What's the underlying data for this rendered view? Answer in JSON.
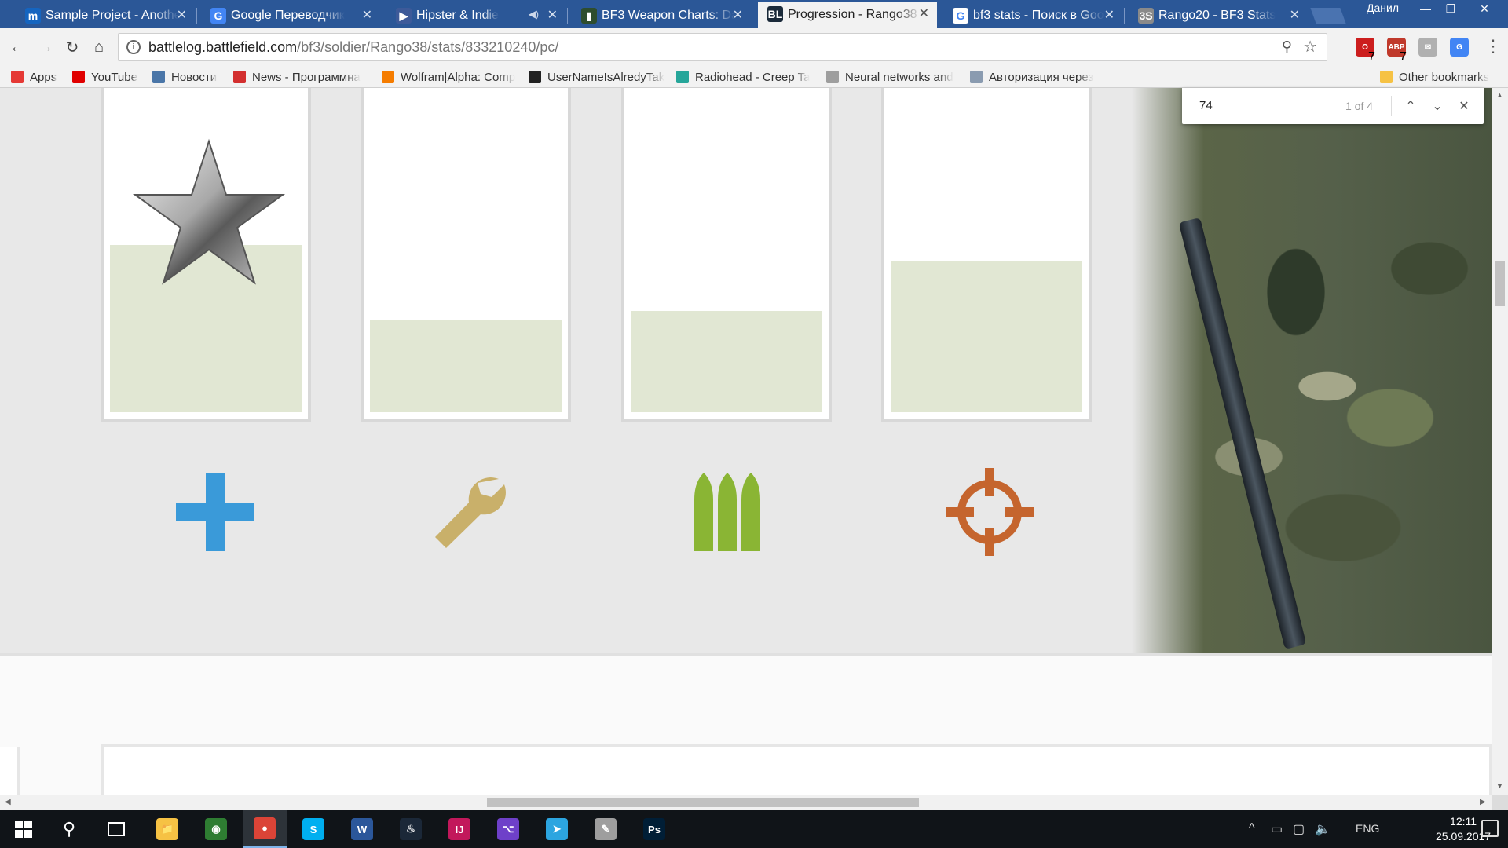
{
  "browser": {
    "tabs": [
      {
        "title": "Sample Project - Anothe",
        "favicon": "m",
        "color": "#1565c0",
        "active": false
      },
      {
        "title": "Google Переводчик",
        "favicon": "G",
        "color": "#4285f4",
        "active": false
      },
      {
        "title": "Hipster & Indie",
        "favicon": "▶",
        "color": "#3d5a99",
        "active": false,
        "audio": true
      },
      {
        "title": "BF3 Weapon Charts: Dar",
        "favicon": "▮",
        "color": "#2e4d2e",
        "active": false
      },
      {
        "title": "Progression - Rango38 -",
        "favicon": "BL",
        "color": "#1b2a3a",
        "active": true
      },
      {
        "title": "bf3 stats - Поиск в Goo",
        "favicon": "G",
        "color": "#ffffff",
        "active": false
      },
      {
        "title": "Rango20 - BF3 Stats",
        "favicon": "3S",
        "color": "#8a8a8a",
        "active": false
      }
    ],
    "user": "Данил",
    "window_controls": {
      "minimize": "—",
      "restore": "❐",
      "close": "✕"
    },
    "url": {
      "host": "battlelog.battlefield.com",
      "path": "/bf3/soldier/Rango38/stats/833210240/pc/"
    },
    "extensions": [
      {
        "name": "opera-extension-icon",
        "label": "O",
        "color": "#cc1e1e",
        "badge": "7"
      },
      {
        "name": "adblock-icon",
        "label": "ABP",
        "color": "#c0392b",
        "badge": "7"
      },
      {
        "name": "pdf-extension-icon",
        "label": "✉",
        "color": "#b0b0b0",
        "badge": ""
      },
      {
        "name": "translate-extension-icon",
        "label": "G",
        "color": "#4285f4",
        "badge": ""
      }
    ],
    "bookmarks": [
      {
        "label": "Apps",
        "icon": "apps-grid-icon",
        "color": "#e53935"
      },
      {
        "label": "YouTube",
        "icon": "youtube-icon",
        "color": "#e00000"
      },
      {
        "label": "Новости",
        "icon": "vk-icon",
        "color": "#4a76a8"
      },
      {
        "label": "News - Программна",
        "icon": "bt-icon",
        "color": "#d32f2f"
      },
      {
        "label": "Wolfram|Alpha: Comp",
        "icon": "wolfram-icon",
        "color": "#f57c00"
      },
      {
        "label": "UserNameIsAlredyTak",
        "icon": "github-icon",
        "color": "#222222"
      },
      {
        "label": "Radiohead - Creep Ta",
        "icon": "play-circle-icon",
        "color": "#26a69a"
      },
      {
        "label": "Neural networks and",
        "icon": "page-icon",
        "color": "#9e9e9e"
      },
      {
        "label": "Авторизация через",
        "icon": "h-icon",
        "color": "#8a9bb0"
      }
    ],
    "other_bookmarks": "Other bookmarks"
  },
  "find_bar": {
    "query": "74",
    "count": "1 of 4",
    "prev": "⌃",
    "next": "⌄",
    "close": "✕"
  },
  "page": {
    "progress_cards": [
      {
        "name": "assault",
        "fill": 0.51,
        "has_star": true
      },
      {
        "name": "engineer",
        "fill": 0.28,
        "has_star": false
      },
      {
        "name": "support",
        "fill": 0.31,
        "has_star": false
      },
      {
        "name": "recon",
        "fill": 0.46,
        "has_star": false
      }
    ],
    "class_icons": [
      {
        "name": "assault-plus-icon",
        "color": "#3a9ad9"
      },
      {
        "name": "engineer-wrench-icon",
        "color": "#c9b06a"
      },
      {
        "name": "support-ammo-icon",
        "color": "#8ab534"
      },
      {
        "name": "recon-crosshair-icon",
        "color": "#c5652e"
      }
    ]
  },
  "taskbar": {
    "apps": [
      {
        "name": "file-explorer-icon",
        "label": "📁",
        "color": "#f6c244"
      },
      {
        "name": "app-green-icon",
        "label": "◉",
        "color": "#2e7d32"
      },
      {
        "name": "chrome-icon",
        "label": "●",
        "color": "#db4437",
        "active": true
      },
      {
        "name": "skype-icon",
        "label": "S",
        "color": "#00aff0"
      },
      {
        "name": "word-icon",
        "label": "W",
        "color": "#2b579a"
      },
      {
        "name": "steam-icon",
        "label": "♨",
        "color": "#1b2838"
      },
      {
        "name": "intellij-icon",
        "label": "IJ",
        "color": "#c2185b"
      },
      {
        "name": "github-desktop-icon",
        "label": "⌥",
        "color": "#6e40c9"
      },
      {
        "name": "telegram-icon",
        "label": "➤",
        "color": "#2ca5e0"
      },
      {
        "name": "paint-icon",
        "label": "✎",
        "color": "#9e9e9e"
      },
      {
        "name": "photoshop-icon",
        "label": "Ps",
        "color": "#001e36"
      }
    ],
    "tray": {
      "lang": "ENG",
      "time": "12:11",
      "date": "25.09.2017"
    }
  }
}
